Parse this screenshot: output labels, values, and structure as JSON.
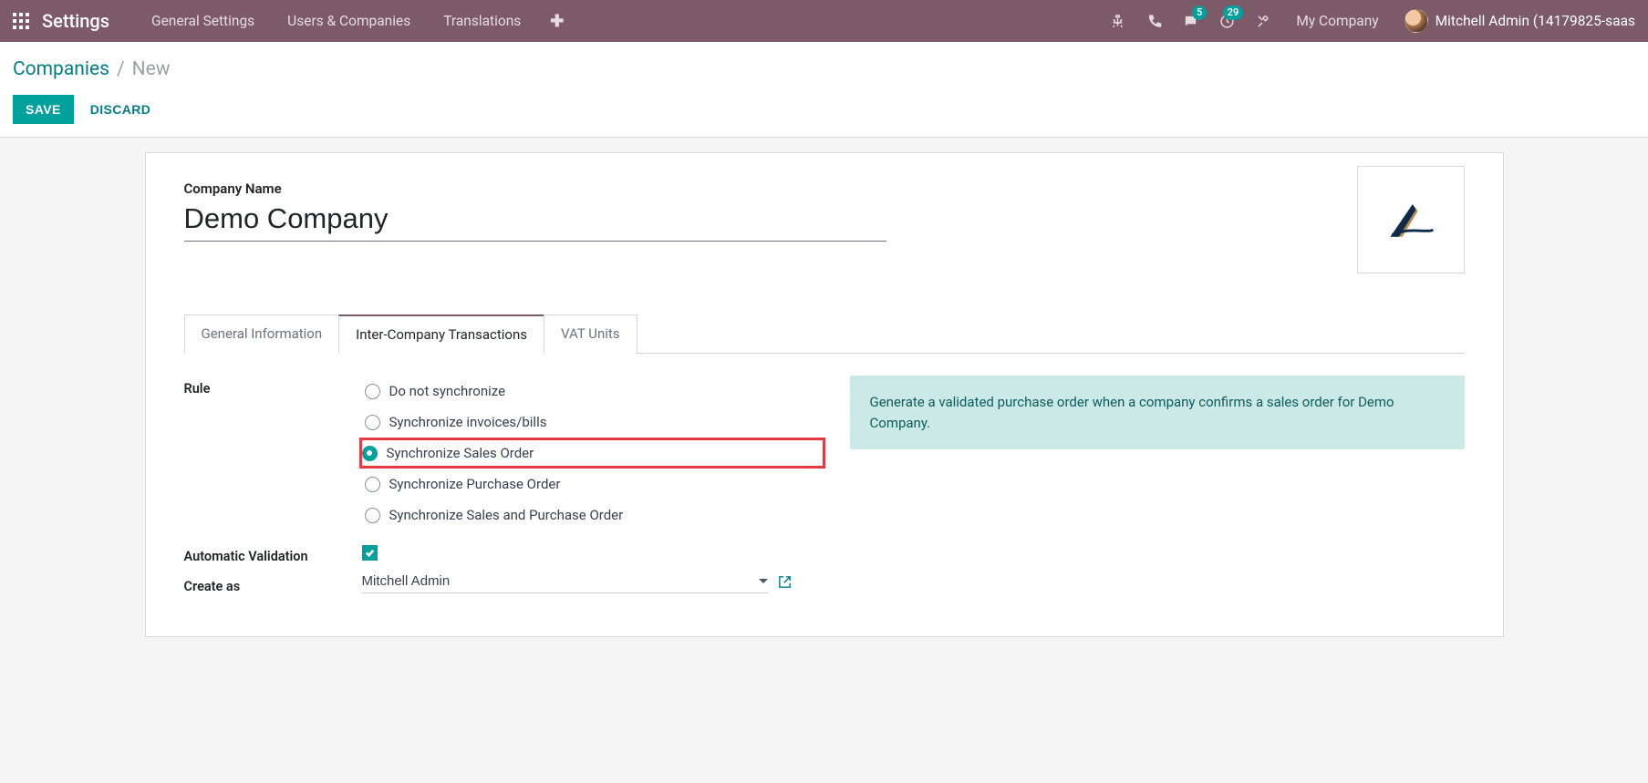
{
  "navbar": {
    "brand": "Settings",
    "menu": [
      "General Settings",
      "Users & Companies",
      "Translations"
    ],
    "messages_badge": "5",
    "activities_badge": "29",
    "company": "My Company",
    "username": "Mitchell Admin (14179825-saas"
  },
  "breadcrumb": {
    "parent": "Companies",
    "current": "New"
  },
  "buttons": {
    "save": "SAVE",
    "discard": "DISCARD"
  },
  "form": {
    "company_name_label": "Company Name",
    "company_name_value": "Demo Company"
  },
  "tabs": [
    "General Information",
    "Inter-Company Transactions",
    "VAT Units"
  ],
  "rule": {
    "label": "Rule",
    "options": [
      "Do not synchronize",
      "Synchronize invoices/bills",
      "Synchronize Sales Order",
      "Synchronize Purchase Order",
      "Synchronize Sales and Purchase Order"
    ],
    "selected_index": 2
  },
  "auto_validation": {
    "label": "Automatic Validation",
    "checked": true
  },
  "create_as": {
    "label": "Create as",
    "value": "Mitchell Admin"
  },
  "info_text": "Generate a validated purchase order when a company confirms a sales order for Demo Company."
}
